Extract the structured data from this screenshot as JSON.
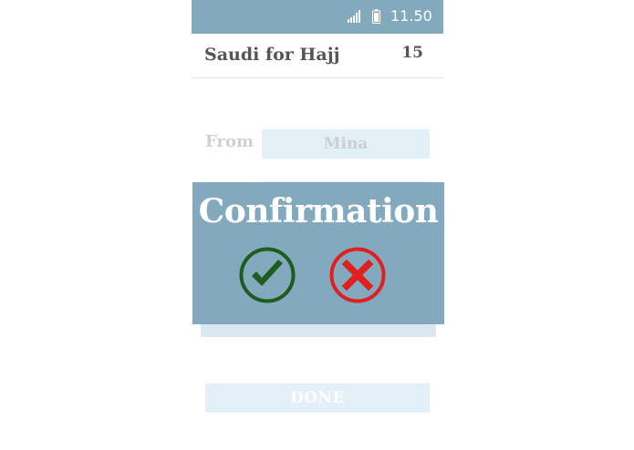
{
  "status_bar": {
    "time": "11.50",
    "icons": [
      "signal-icon",
      "battery-icon"
    ]
  },
  "header": {
    "title": "Saudi for Hajj",
    "count": "15"
  },
  "form": {
    "from_label": "From",
    "from_value": "Mina",
    "to_value": "",
    "done_label": "DONE"
  },
  "dialog": {
    "title": "Confirmation",
    "confirm_icon": "check-circle-icon",
    "cancel_icon": "x-circle-icon"
  },
  "colors": {
    "status_bar": "#83a9bd",
    "dialog": "#82a9bd",
    "confirm": "#1f5c1f",
    "cancel": "#e02020",
    "field": "#e3f0f7"
  }
}
